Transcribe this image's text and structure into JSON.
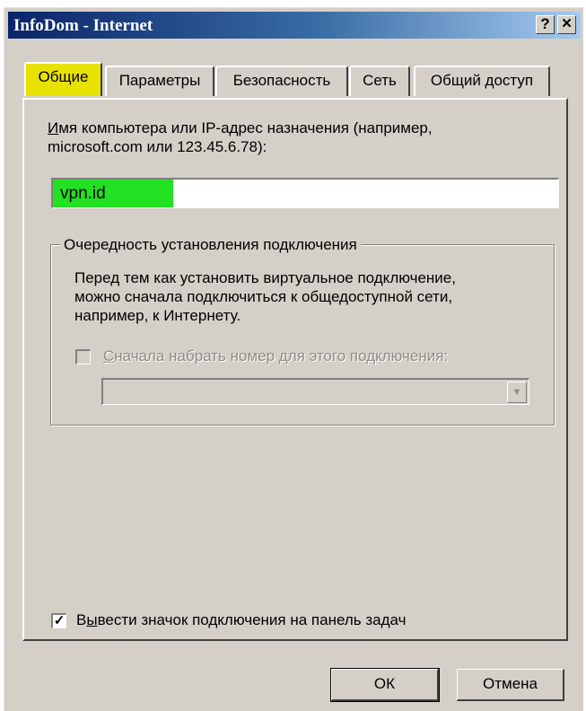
{
  "window": {
    "title": "InfoDom - Internet",
    "help_glyph": "?",
    "close_glyph": "✕"
  },
  "tabs": [
    {
      "label": "Общие",
      "active": true
    },
    {
      "label": "Параметры",
      "active": false
    },
    {
      "label": "Безопасность",
      "active": false
    },
    {
      "label": "Сеть",
      "active": false
    },
    {
      "label": "Общий доступ",
      "active": false
    }
  ],
  "general": {
    "host_label_line1_first": "И",
    "host_label_line1_rest": "мя компьютера или IP-адрес назначения (например,",
    "host_label_line2": "microsoft.com или 123.45.6.78):",
    "host_value": "vpn.id",
    "group_title": "Очередность установления подключения",
    "group_desc_line1": "Перед тем как установить виртуальное подключение,",
    "group_desc_line2": "можно сначала подключиться к общедоступной сети,",
    "group_desc_line3": "например, к Интернету.",
    "dial_first_label_first": "С",
    "dial_first_label_rest": "начала набрать номер для этого подключения:",
    "dial_first_checked": false,
    "dial_combo_value": "",
    "show_icon_first": "В",
    "show_icon_key": "ы",
    "show_icon_rest": "вести значок подключения на панель задач",
    "show_icon_checked": true,
    "check_glyph": "✓"
  },
  "footer": {
    "ok_label": "ОК",
    "cancel_label": "Отмена"
  },
  "colors": {
    "active_tab_highlight": "#e8e200",
    "host_highlight": "#22e022",
    "titlebar_start": "#0a246a",
    "titlebar_end": "#a6caf0"
  }
}
